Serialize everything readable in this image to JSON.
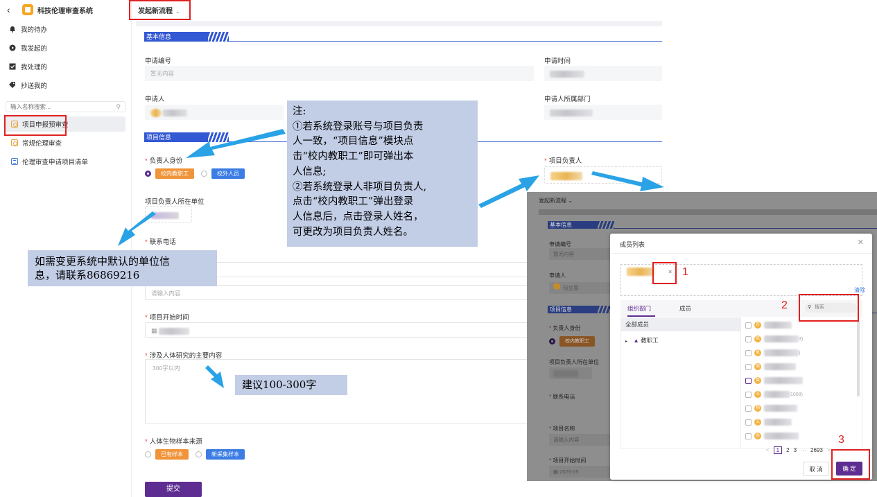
{
  "app": {
    "title": "科技伦理审查系统"
  },
  "sidebar": {
    "nav": [
      {
        "label": "我的待办",
        "icon": "bell-icon"
      },
      {
        "label": "我发起的",
        "icon": "play-icon"
      },
      {
        "label": "我处理的",
        "icon": "checkbox-icon"
      },
      {
        "label": "抄送我的",
        "icon": "tag-icon"
      }
    ],
    "search_placeholder": "输入名称搜索...",
    "menu": [
      {
        "label": "项目申报预审查",
        "active": true
      },
      {
        "label": "常规伦理审查",
        "active": false
      },
      {
        "label": "伦理审查申请项目清单",
        "active": false
      }
    ]
  },
  "topbar": {
    "launch_label": "发起新流程",
    "launch_chevron": "⌄"
  },
  "form": {
    "section_basic": "基本信息",
    "app_no_label": "申请编号",
    "app_no_value": "暂无内容",
    "app_time_label": "申请时间",
    "applicant_label": "申请人",
    "dept_label": "申请人所属部门",
    "section_project": "项目信息",
    "leader_identity_label": "负责人身份",
    "identity_options": [
      "校内教职工",
      "校外人员"
    ],
    "leader_label": "项目负责人",
    "unit_label": "项目负责人所在单位",
    "phone_label": "联系电话",
    "name_placeholder": "请输入内容",
    "start_time_label": "项目开始时间",
    "content_label": "涉及人体研究的主要内容",
    "content_placeholder": "300字以内",
    "sample_label": "人体生物样本来源",
    "sample_options": [
      "已有样本",
      "新采集样本"
    ],
    "submit_label": "提交",
    "required_mark": "*"
  },
  "callouts": {
    "note_title": "注:",
    "note_line1": "①若系统登录账号与项目负责",
    "note_line2": "人一致，“项目信息”模块点",
    "note_line3": "击“校内教职工”即可弹出本",
    "note_line4": "人信息;",
    "note_line5": "②若系统登录人非项目负责人,",
    "note_line6": "点击“校内教职工”弹出登录",
    "note_line7": "人信息后，点击登录人姓名，",
    "note_line8": "可更改为项目负责人姓名。",
    "unit_line1": "如需变更系统中默认的单位信",
    "unit_line2": "息，请联系86869216",
    "suggest": "建议100-300字"
  },
  "overlay": {
    "top_label": "发起新流程",
    "section_basic": "基本信息",
    "app_no_label": "申请编号",
    "app_no_value": "暂无内容",
    "applicant_label": "申请人",
    "applicant_name": "包立晨",
    "section_project": "项目信息",
    "identity_label": "负责人身份",
    "identity_tag": "校内教职工",
    "unit_label": "项目负责人所在单位",
    "phone_label": "联系电话",
    "project_name_label": "项目名称",
    "project_name_placeholder": "请输入内容",
    "start_label": "项目开始时间",
    "start_value": "2025-05"
  },
  "modal": {
    "title": "成员列表",
    "clear_label": "清除",
    "tabs": [
      "组织部门",
      "成员"
    ],
    "search_placeholder": "搜索",
    "tree": [
      "全部成员",
      "教职工"
    ],
    "members": [
      {
        "avatar": "许",
        "suffix": ""
      },
      {
        "avatar": "陈",
        "suffix": "3)"
      },
      {
        "avatar": "夏",
        "suffix": ")"
      },
      {
        "avatar": "周",
        "suffix": ""
      },
      {
        "avatar": "苗",
        "suffix": ""
      },
      {
        "avatar": "王",
        "suffix": "1008)"
      },
      {
        "avatar": "杨",
        "suffix": ""
      },
      {
        "avatar": "王",
        "suffix": ""
      },
      {
        "avatar": "余",
        "suffix": ""
      }
    ],
    "pager": {
      "pages": [
        "1",
        "2",
        "3"
      ],
      "ellipsis": "···",
      "last": "2693",
      "prev": "<",
      "next": ">"
    },
    "cancel_label": "取 消",
    "ok_label": "确 定",
    "steps": [
      "1",
      "2",
      "3"
    ]
  },
  "colors": {
    "primary": "#5d2d91",
    "section": "#3358d4",
    "callout_bg": "#c2cde6",
    "annotation_red": "#e02020",
    "arrow": "#2aa3e6"
  }
}
